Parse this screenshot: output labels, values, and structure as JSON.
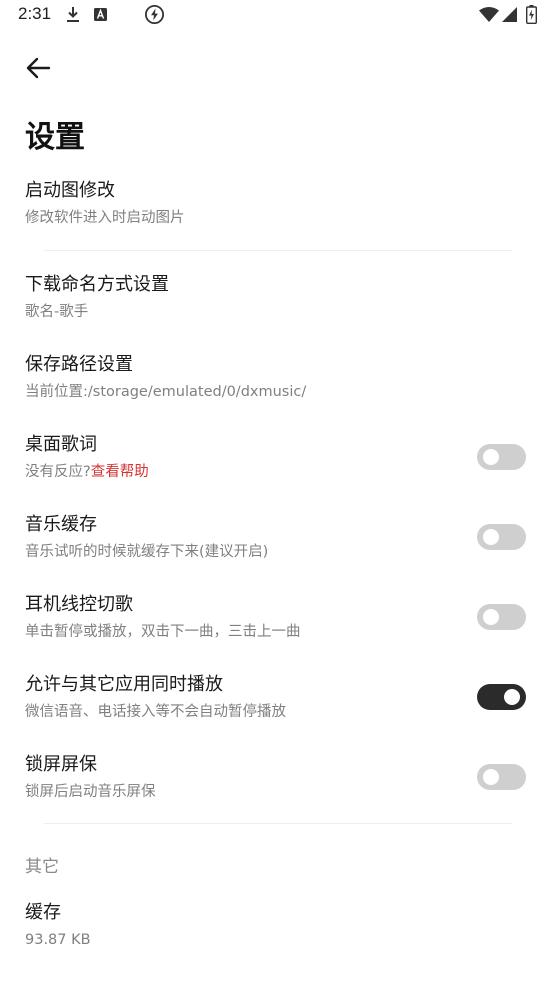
{
  "status_bar": {
    "time": "2:31",
    "icons": [
      "download-icon",
      "a-badge-icon",
      "flash-icon",
      "wifi-icon",
      "signal-icon",
      "battery-icon"
    ]
  },
  "page": {
    "title": "设置",
    "back_icon": "arrow-left-icon"
  },
  "settings": [
    {
      "title": "启动图修改",
      "subtitle": "修改软件进入时启动图片"
    },
    {
      "title": "下载命名方式设置",
      "subtitle": "歌名-歌手"
    },
    {
      "title": "保存路径设置",
      "subtitle": "当前位置:/storage/emulated/0/dxmusic/"
    },
    {
      "title": "桌面歌词",
      "subtitle": "没有反应?",
      "link": "查看帮助",
      "toggle": false
    },
    {
      "title": "音乐缓存",
      "subtitle": "音乐试听的时候就缓存下来(建议开启)",
      "toggle": false
    },
    {
      "title": "耳机线控切歌",
      "subtitle": "单击暂停或播放，双击下一曲，三击上一曲",
      "toggle": false
    },
    {
      "title": "允许与其它应用同时播放",
      "subtitle": "微信语音、电话接入等不会自动暂停播放",
      "toggle": true
    },
    {
      "title": "锁屏屏保",
      "subtitle": "锁屏后启动音乐屏保",
      "toggle": false
    }
  ],
  "other_section": {
    "header": "其它",
    "cache": {
      "title": "缓存",
      "value": "93.87 KB"
    }
  },
  "colors": {
    "link": "#d83232",
    "toggle_on": "#2b2b2b",
    "toggle_off": "#cfcfcf",
    "subtitle": "#808080"
  }
}
